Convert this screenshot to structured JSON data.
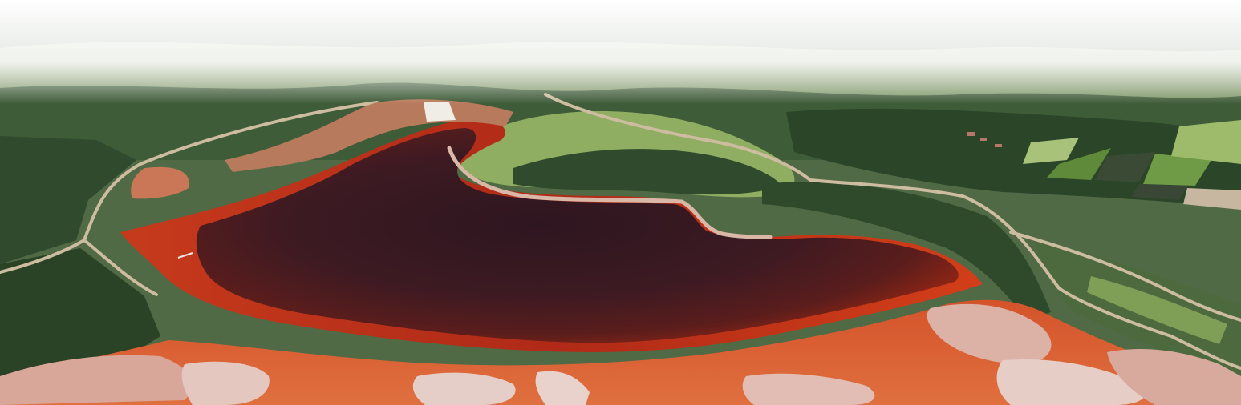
{
  "image": {
    "kind": "aerial-photograph",
    "palette": {
      "haze": "#f4f5f3",
      "forest_dark": "#2f4a2c",
      "forest_mid": "#4c6b3f",
      "pasture": "#8fae62",
      "pasture_light": "#a8c47a",
      "water_dark": "#3a1a22",
      "water_deep_red": "#7a1f18",
      "water_edge_red": "#c9361a",
      "mud_orange": "#d8582a",
      "tailings_pink": "#d9a79a",
      "tailings_light": "#e9d2cc",
      "road_tan": "#c9b79c",
      "field_green": "#5f8a3a",
      "field_dark": "#3b4a34"
    }
  }
}
